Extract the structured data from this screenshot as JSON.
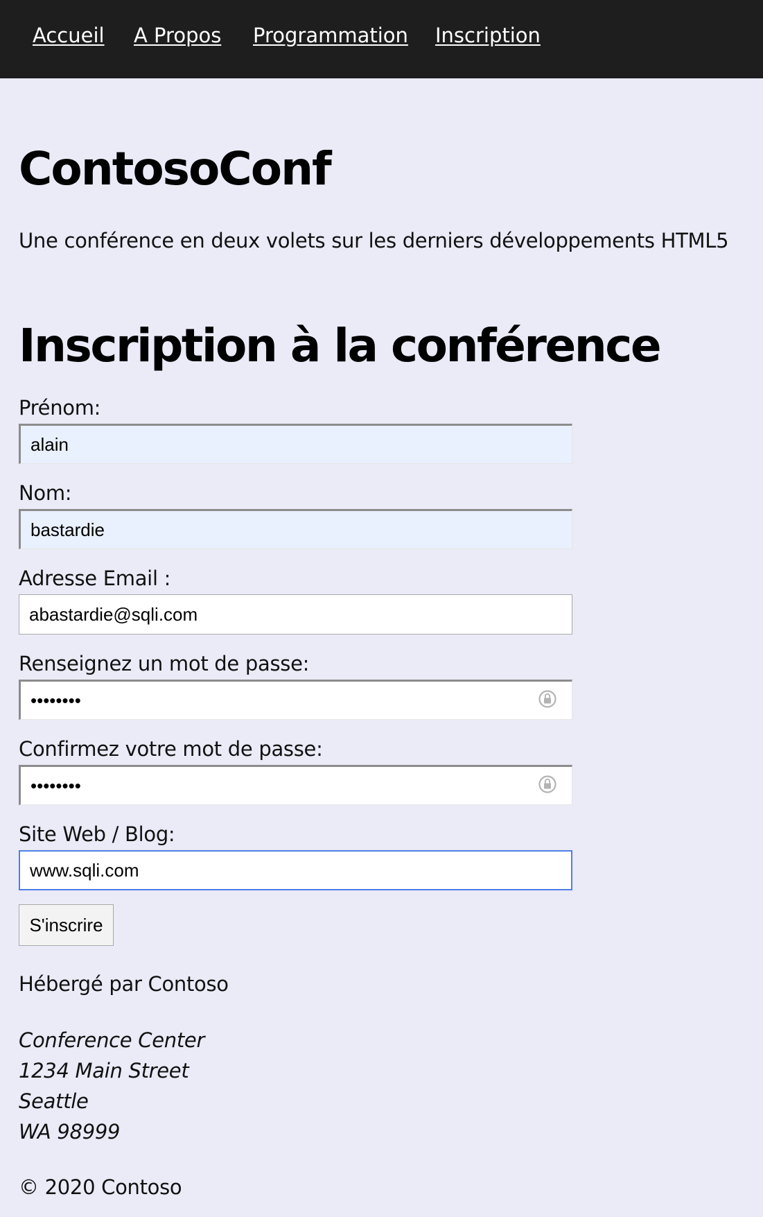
{
  "nav": {
    "items": [
      {
        "label": "Accueil"
      },
      {
        "label": "A Propos"
      },
      {
        "label": "Programmation"
      },
      {
        "label": "Inscription"
      }
    ]
  },
  "header": {
    "title": "ContosoConf",
    "tagline": "Une conférence en deux volets sur les derniers développements HTML5"
  },
  "form": {
    "title": "Inscription à la conférence",
    "first_name": {
      "label": "Prénom:",
      "value": "alain"
    },
    "last_name": {
      "label": "Nom:",
      "value": "bastardie"
    },
    "email": {
      "label": "Adresse Email :",
      "value": "abastardie@sqli.com"
    },
    "password": {
      "label": "Renseignez un mot de passe:",
      "value": "alainbas"
    },
    "confirm_password": {
      "label": "Confirmez votre mot de passe:",
      "value": "alainbas"
    },
    "website": {
      "label": "Site Web / Blog:",
      "value": "www.sqli.com"
    },
    "submit_label": "S'inscrire"
  },
  "footer": {
    "host": "Hébergé par Contoso",
    "address": [
      "Conference Center",
      "1234 Main Street",
      "Seattle",
      "WA 98999"
    ],
    "copyright": "© 2020 Contoso"
  },
  "colors": {
    "nav_background": "#1e1e1e",
    "page_background": "#eaebf7",
    "autofill_background": "#e9f0fe",
    "focus_border": "#4d7ee8"
  },
  "icons": {
    "password_manager": "key-lock-icon"
  }
}
